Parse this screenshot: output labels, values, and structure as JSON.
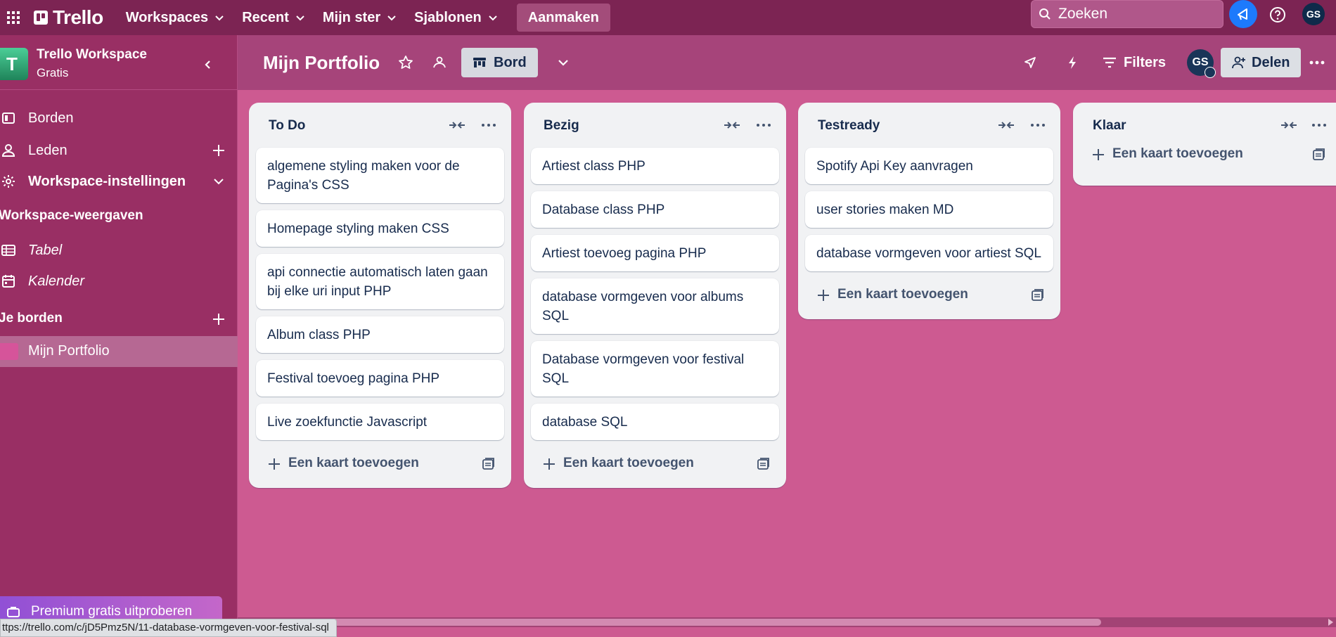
{
  "topbar": {
    "logo_text": "Trello",
    "menus": [
      "Workspaces",
      "Recent",
      "Mijn ster",
      "Sjablonen"
    ],
    "create_label": "Aanmaken",
    "search_placeholder": "Zoeken",
    "avatar_initials": "GS"
  },
  "sidebar": {
    "workspace_initial": "T",
    "workspace_name": "Trello Workspace",
    "workspace_plan": "Gratis",
    "items": [
      {
        "label": "Borden",
        "icon": "board-icon"
      },
      {
        "label": "Leden",
        "icon": "member-icon"
      },
      {
        "label": "Workspace-instellingen",
        "icon": "gear-icon"
      }
    ],
    "views_heading": "Workspace-weergaven",
    "views": [
      {
        "label": "Tabel",
        "icon": "table-icon"
      },
      {
        "label": "Kalender",
        "icon": "calendar-icon"
      }
    ],
    "boards_heading": "Je borden",
    "boards": [
      {
        "label": "Mijn Portfolio"
      }
    ],
    "premium_label": "Premium gratis uitproberen"
  },
  "board": {
    "title": "Mijn Portfolio",
    "view_label": "Bord",
    "filters_label": "Filters",
    "member_initials": "GS",
    "share_label": "Delen"
  },
  "lists": [
    {
      "title": "To Do",
      "cards": [
        "algemene styling maken voor de Pagina's CSS",
        "Homepage styling maken CSS",
        "api connectie automatisch laten gaan bij elke uri input PHP",
        "Album class PHP",
        "Festival toevoeg pagina PHP",
        "Live zoekfunctie Javascript"
      ],
      "add_label": "Een kaart toevoegen"
    },
    {
      "title": "Bezig",
      "cards": [
        "Artiest class PHP",
        "Database class PHP",
        "Artiest toevoeg pagina PHP",
        "database vormgeven voor albums SQL",
        "Database vormgeven voor festival SQL",
        "database SQL"
      ],
      "add_label": "Een kaart toevoegen"
    },
    {
      "title": "Testready",
      "cards": [
        "Spotify Api Key aanvragen",
        "user stories maken MD",
        "database vormgeven voor artiest SQL"
      ],
      "add_label": "Een kaart toevoegen"
    },
    {
      "title": "Klaar",
      "cards": [],
      "add_label": "Een kaart toevoegen"
    }
  ],
  "status_bar": {
    "url": "ttps://trello.com/c/jD5Pmz5N/11-database-vormgeven-voor-festival-sql"
  },
  "colors": {
    "topbar": "#7c2453",
    "sidebar": "#992f64",
    "board_background": "#cd5a91",
    "list_background": "#f1f2f4",
    "accent_blue": "#1d7afc"
  }
}
